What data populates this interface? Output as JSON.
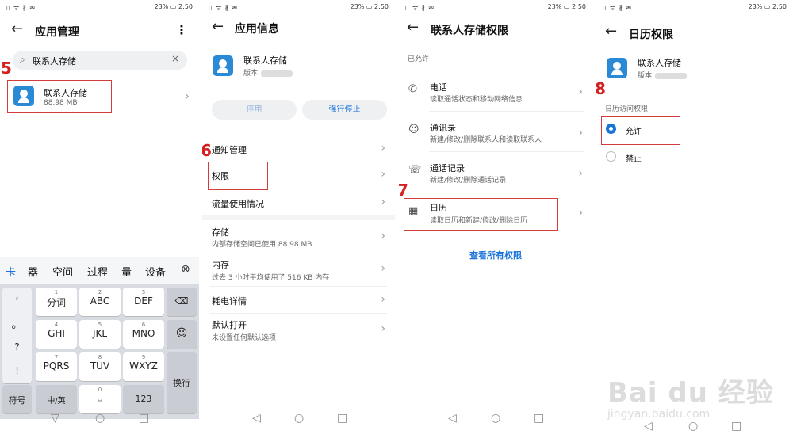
{
  "status": {
    "icons": "▯ ᯤ ∦ ✉",
    "battery": "23% ▭ 2:50"
  },
  "panel1": {
    "title": "应用管理",
    "step": "5",
    "search_value": "联系人存储",
    "app": {
      "name": "联系人存储",
      "size": "88.98 MB"
    },
    "suggestions": [
      "卡",
      "器",
      "空间",
      "过程",
      "量",
      "设备"
    ],
    "keys": {
      "punct": [
        ",",
        "。",
        "?",
        "!"
      ],
      "row1": [
        {
          "num": "1",
          "label": "分词"
        },
        {
          "num": "2",
          "label": "ABC"
        },
        {
          "num": "3",
          "label": "DEF"
        }
      ],
      "row2": [
        {
          "num": "4",
          "label": "GHI"
        },
        {
          "num": "5",
          "label": "JKL"
        },
        {
          "num": "6",
          "label": "MNO"
        }
      ],
      "row3": [
        {
          "num": "7",
          "label": "PQRS"
        },
        {
          "num": "8",
          "label": "TUV"
        },
        {
          "num": "9",
          "label": "WXYZ"
        }
      ],
      "fuhao": "符号",
      "zhong": "中/英",
      "num0": "0",
      "n123": "123",
      "huanhang": "换行"
    }
  },
  "panel2": {
    "title": "应用信息",
    "step": "6",
    "app": {
      "name": "联系人存储",
      "version_label": "版本"
    },
    "btn_disable": "停用",
    "btn_force": "强行停止",
    "items": [
      {
        "label": "通知管理",
        "sub": ""
      },
      {
        "label": "权限",
        "sub": ""
      },
      {
        "label": "流量使用情况",
        "sub": ""
      },
      {
        "label": "存储",
        "sub": "内部存储空间已使用 88.98 MB"
      },
      {
        "label": "内存",
        "sub": "过去 3 小时平均使用了 516 KB 内存"
      },
      {
        "label": "耗电详情",
        "sub": ""
      },
      {
        "label": "默认打开",
        "sub": "未设置任何默认选项"
      }
    ]
  },
  "panel3": {
    "title": "联系人存储权限",
    "step": "7",
    "section": "已允许",
    "items": [
      {
        "label": "电话",
        "sub": "读取通话状态和移动网络信息"
      },
      {
        "label": "通讯录",
        "sub": "新建/修改/删除联系人和读取联系人"
      },
      {
        "label": "通话记录",
        "sub": "新建/修改/删除通话记录"
      },
      {
        "label": "日历",
        "sub": "读取日历和新建/修改/删除日历"
      }
    ],
    "view_all": "查看所有权限"
  },
  "panel4": {
    "title": "日历权限",
    "step": "8",
    "app": {
      "name": "联系人存储",
      "version_label": "版本"
    },
    "section": "日历访问权限",
    "allow": "允许",
    "deny": "禁止"
  },
  "watermark": {
    "brand": "Bai du 经验",
    "url": "jingyan.baidu.com"
  },
  "colors": {
    "accent": "#1a73d9",
    "highlight": "#d43b3b"
  }
}
